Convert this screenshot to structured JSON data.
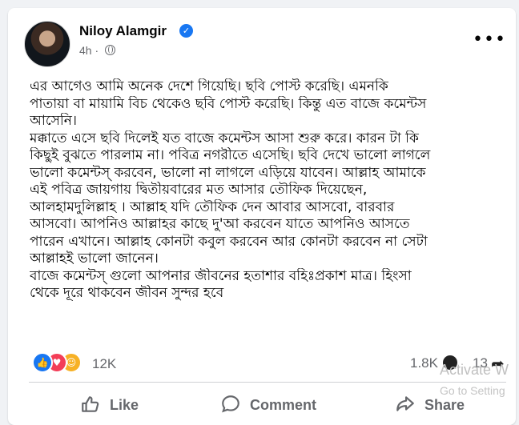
{
  "post": {
    "author": "Niloy Alamgir",
    "time": "4h",
    "lines": [
      "এর আগেও আমি অনেক দেশে গিয়েছি। ছবি পোস্ট করেছি। এমনকি",
      "পাতায়া বা মায়ামি বিচ থেকেও ছবি পোস্ট করেছি। কিন্তু এত বাজে কমেন্টস",
      "আসেনি।",
      "মক্কাতে এসে ছবি দিলেই যত বাজে কমেন্টস আসা শুরু করে। কারন টা কি",
      "কিছুই বুঝতে পারলাম না। পবিত্র নগরীতে এসেছি। ছবি দেখে ভালো লাগলে",
      "ভালো কমেন্টস্ করবেন, ভালো না লাগলে এড়িয়ে যাবেন। আল্লাহ আমাকে",
      "এই পবিত্র জায়গায় দ্বিতীয়বারের মত আসার তৌফিক দিয়েছেন,",
      "আলহামদুলিল্লাহ । আল্লাহ যদি তৌফিক দেন আবার আসবো, বারবার",
      "আসবো। আপনিও আল্লাহর কাছে দু'আ করবেন যাতে আপনিও আসতে",
      "পারেন এখানে। আল্লাহ কোনটা কবুল করবেন আর কোনটা করবেন না সেটা",
      "আল্লাহই ভালো জানেন।",
      "বাজে কমেন্টস্ গুলো আপনার জীবনের হতাশার বহিঃপ্রকাশ মাত্র। হিংসা",
      "থেকে দূরে থাকবেন জীবন সুন্দর হবে"
    ]
  },
  "stats": {
    "reactions": "12K",
    "comments": "1.8K",
    "shares": "13",
    "reaction_icons": [
      "like-icon",
      "love-icon",
      "care-icon"
    ]
  },
  "actions": {
    "like": "Like",
    "comment": "Comment",
    "share": "Share"
  },
  "watermark": {
    "line1": "Activate W",
    "line2": "Go to Setting"
  },
  "colors": {
    "brand": "#1877f2",
    "love": "#f33e58",
    "care": "#f7b125",
    "secondary_text": "#65676b"
  }
}
